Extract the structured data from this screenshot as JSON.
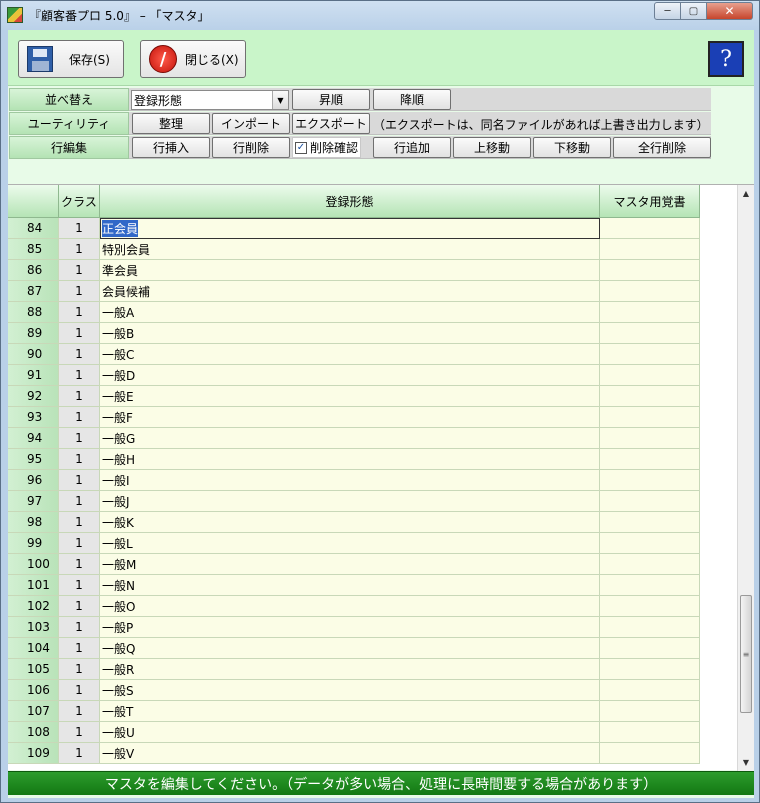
{
  "window": {
    "title": "『顧客番プロ 5.0』 – 「マスタ」",
    "controls": {
      "minimize": "─",
      "maximize": "▢",
      "close": "✕"
    }
  },
  "toolbar": {
    "save_label": "保存(S)",
    "close_label": "閉じる(X)",
    "close_icon_glyph": "/",
    "help_label": "?"
  },
  "options": {
    "sort": {
      "label": "並べ替え",
      "selected": "登録形態",
      "arrow": "▼",
      "asc": "昇順",
      "desc": "降順"
    },
    "utility": {
      "label": "ユーティリティ",
      "organize": "整理",
      "import": "インポート",
      "export": "エクスポート",
      "note": "（エクスポートは、同名ファイルがあれば上書き出力します）"
    },
    "row_edit": {
      "label": "行編集",
      "insert": "行挿入",
      "delete": "行削除",
      "confirm_delete": "削除確認",
      "confirm_checked": "✓",
      "add": "行追加",
      "move_up": "上移動",
      "move_down": "下移動",
      "delete_all": "全行削除"
    }
  },
  "grid": {
    "columns": [
      "",
      "クラス",
      "登録形態",
      "マスタ用覚書"
    ],
    "rows": [
      {
        "num": "84",
        "cls": "1",
        "name": "正会員",
        "memo": ""
      },
      {
        "num": "85",
        "cls": "1",
        "name": "特別会員",
        "memo": ""
      },
      {
        "num": "86",
        "cls": "1",
        "name": "準会員",
        "memo": ""
      },
      {
        "num": "87",
        "cls": "1",
        "name": "会員候補",
        "memo": ""
      },
      {
        "num": "88",
        "cls": "1",
        "name": "一般A",
        "memo": ""
      },
      {
        "num": "89",
        "cls": "1",
        "name": "一般B",
        "memo": ""
      },
      {
        "num": "90",
        "cls": "1",
        "name": "一般C",
        "memo": ""
      },
      {
        "num": "91",
        "cls": "1",
        "name": "一般D",
        "memo": ""
      },
      {
        "num": "92",
        "cls": "1",
        "name": "一般E",
        "memo": ""
      },
      {
        "num": "93",
        "cls": "1",
        "name": "一般F",
        "memo": ""
      },
      {
        "num": "94",
        "cls": "1",
        "name": "一般G",
        "memo": ""
      },
      {
        "num": "95",
        "cls": "1",
        "name": "一般H",
        "memo": ""
      },
      {
        "num": "96",
        "cls": "1",
        "name": "一般I",
        "memo": ""
      },
      {
        "num": "97",
        "cls": "1",
        "name": "一般J",
        "memo": ""
      },
      {
        "num": "98",
        "cls": "1",
        "name": "一般K",
        "memo": ""
      },
      {
        "num": "99",
        "cls": "1",
        "name": "一般L",
        "memo": ""
      },
      {
        "num": "100",
        "cls": "1",
        "name": "一般M",
        "memo": ""
      },
      {
        "num": "101",
        "cls": "1",
        "name": "一般N",
        "memo": ""
      },
      {
        "num": "102",
        "cls": "1",
        "name": "一般O",
        "memo": ""
      },
      {
        "num": "103",
        "cls": "1",
        "name": "一般P",
        "memo": ""
      },
      {
        "num": "104",
        "cls": "1",
        "name": "一般Q",
        "memo": ""
      },
      {
        "num": "105",
        "cls": "1",
        "name": "一般R",
        "memo": ""
      },
      {
        "num": "106",
        "cls": "1",
        "name": "一般S",
        "memo": ""
      },
      {
        "num": "107",
        "cls": "1",
        "name": "一般T",
        "memo": ""
      },
      {
        "num": "108",
        "cls": "1",
        "name": "一般U",
        "memo": ""
      },
      {
        "num": "109",
        "cls": "1",
        "name": "一般V",
        "memo": ""
      }
    ],
    "selected_row": "84",
    "scroll": {
      "up": "▲",
      "down": "▼",
      "thumb": "≡"
    }
  },
  "status": {
    "message": "マスタを編集してください。（データが多い場合、処理に長時間要する場合があります）"
  }
}
